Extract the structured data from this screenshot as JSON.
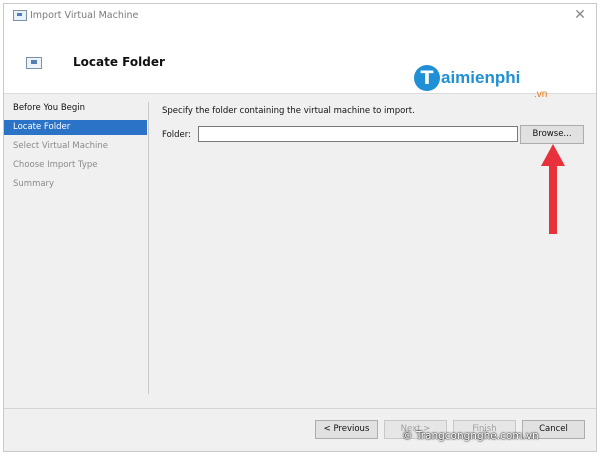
{
  "window": {
    "title": "Import Virtual Machine",
    "close_glyph": "✕"
  },
  "header": {
    "title": "Locate Folder"
  },
  "watermark": {
    "initial": "T",
    "name": "aimienphi",
    "suffix": ".vn"
  },
  "sidebar": {
    "items": [
      {
        "label": "Before You Begin",
        "state": "normal"
      },
      {
        "label": "Locate Folder",
        "state": "active"
      },
      {
        "label": "Select Virtual Machine",
        "state": "disabled"
      },
      {
        "label": "Choose Import Type",
        "state": "disabled"
      },
      {
        "label": "Summary",
        "state": "disabled"
      }
    ]
  },
  "main": {
    "instruction": "Specify the folder containing the virtual machine to import.",
    "folder_label": "Folder:",
    "folder_value": "",
    "browse_label": "Browse..."
  },
  "footer": {
    "previous_label": "< Previous",
    "next_label": "Next >",
    "finish_label": "Finish",
    "cancel_label": "Cancel"
  },
  "credit": "© Trangcongnghe.com.vn",
  "colors": {
    "accent": "#2b73c6",
    "arrow": "#e8323b",
    "logo_blue": "#1f8fd6",
    "logo_orange": "#e67a17"
  },
  "icons": [
    "app-icon",
    "step-icon",
    "close-icon",
    "arrow-annotation"
  ]
}
